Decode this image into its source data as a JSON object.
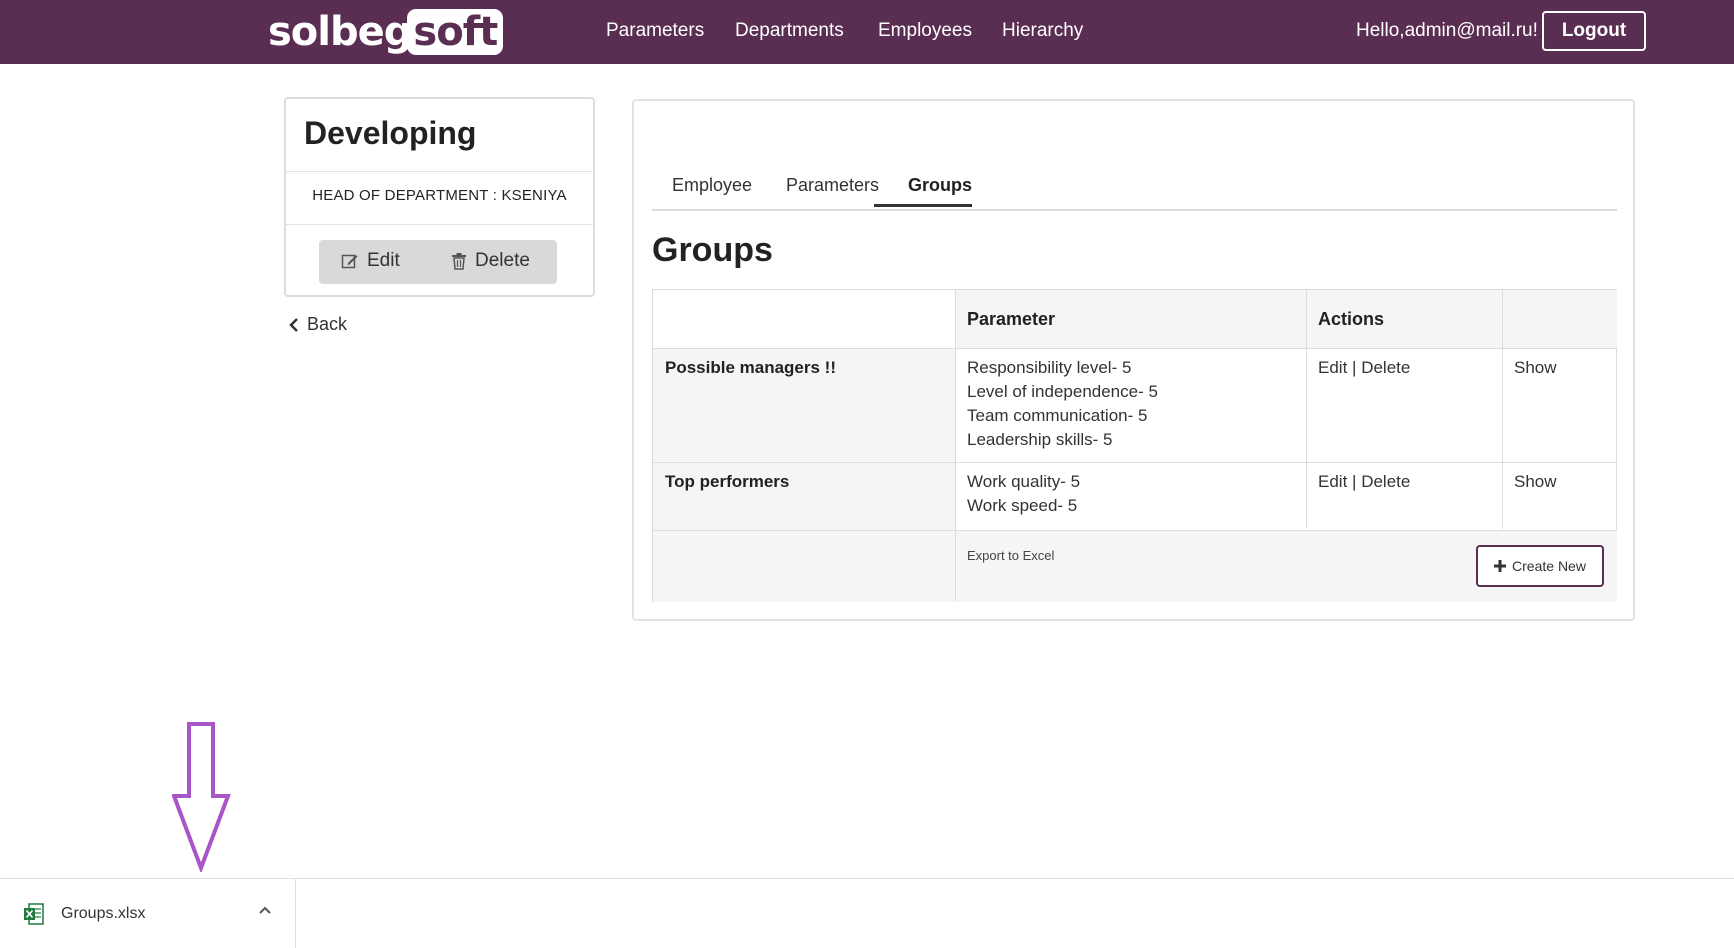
{
  "navbar": {
    "logo_part1": "solbeg",
    "logo_part2": "soft",
    "links": [
      "Parameters",
      "Departments",
      "Employees",
      "Hierarchy"
    ],
    "greeting": "Hello,admin@mail.ru!",
    "logout_label": "Logout"
  },
  "department": {
    "title": "Developing",
    "head_label": "HEAD OF DEPARTMENT : KSENIYA",
    "edit_label": "Edit",
    "delete_label": "Delete"
  },
  "back_label": "Back",
  "tabs": [
    "Employee",
    "Parameters",
    "Groups"
  ],
  "active_tab": "Groups",
  "page_title": "Groups",
  "table": {
    "headers": [
      "",
      "Parameter",
      "Actions",
      ""
    ],
    "rows": [
      {
        "name": "Possible managers !!",
        "params": [
          "Responsibility level- 5",
          "Level of independence- 5",
          "Team communication- 5",
          "Leadership skills- 5"
        ],
        "edit": "Edit",
        "sep": "|",
        "delete": "Delete",
        "show": "Show"
      },
      {
        "name": "Top performers",
        "params": [
          "Work quality- 5",
          "Work speed- 5"
        ],
        "edit": "Edit",
        "sep": "|",
        "delete": "Delete",
        "show": "Show"
      }
    ],
    "export_label": "Export to Excel",
    "create_label": "Create New"
  },
  "download": {
    "filename": "Groups.xlsx"
  },
  "colors": {
    "brand": "#5a2e53",
    "arrow": "#a855c7"
  }
}
